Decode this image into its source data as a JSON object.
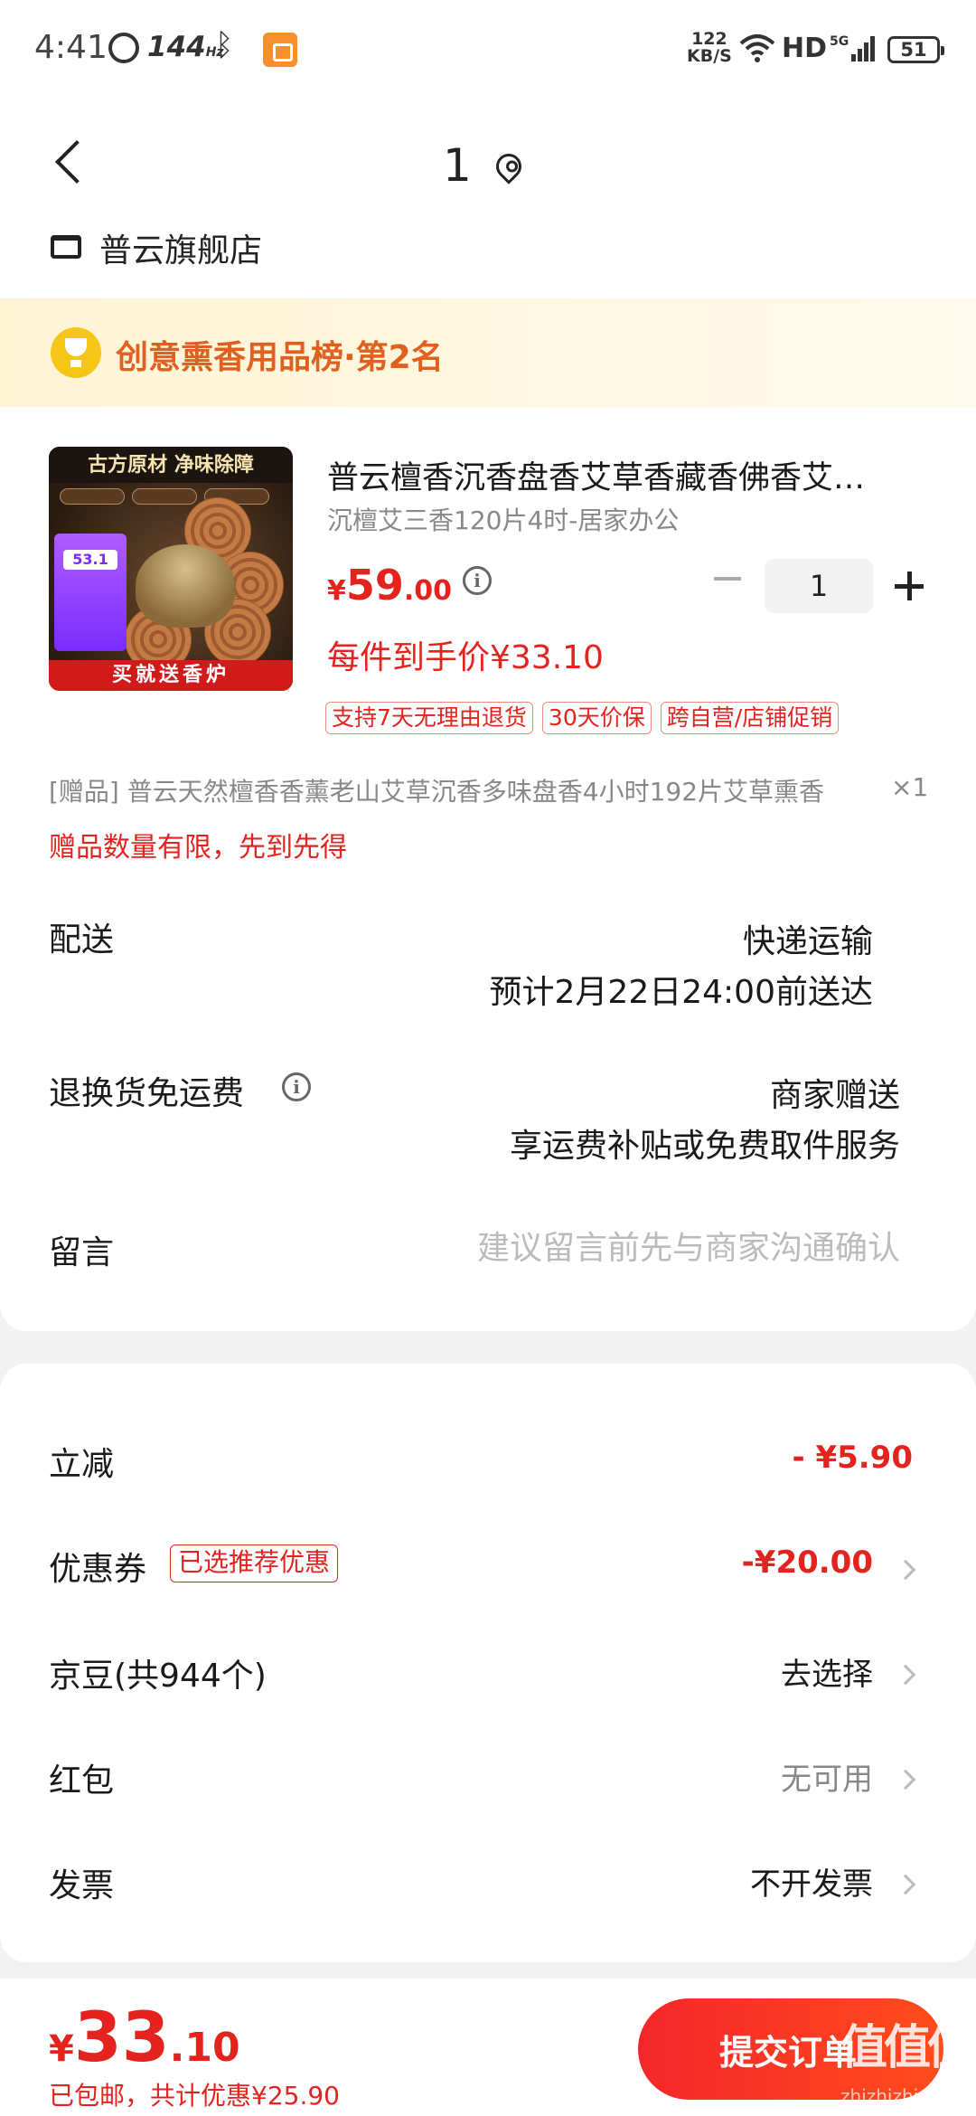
{
  "status_bar": {
    "time": "4:41",
    "refresh_rate": "144",
    "refresh_unit": "Hz",
    "net_speed": "122",
    "net_unit": "KB/S",
    "hd": "HD",
    "net_type": "5G",
    "battery": "51"
  },
  "header": {
    "address": "1",
    "shop_name": "普云旗舰店"
  },
  "rank_banner": {
    "text": "创意熏香用品榜·第2名"
  },
  "product": {
    "image": {
      "top_text": "古方原材 净味除障",
      "promo_text": "53.1",
      "bottom_text": "买就送香炉"
    },
    "title": "普云檀香沉香盘香艾草香藏香佛香艾…",
    "spec": "沉檀艾三香120片4时-居家办公",
    "price_currency": "¥",
    "price_int": "59",
    "price_dec": ".00",
    "quantity": "1",
    "final_price": "每件到手价¥33.10",
    "tags": [
      "支持7天无理由退货",
      "30天价保",
      "跨自营/店铺促销"
    ]
  },
  "gift": {
    "text": "[赠品]  普云天然檀香香薰老山艾草沉香多味盘香4小时192片艾草熏香",
    "qty": "×1",
    "note": "赠品数量有限，先到先得"
  },
  "delivery": {
    "label": "配送",
    "method": "快递运输",
    "eta": "预计2月22日24:00前送达"
  },
  "return_freight": {
    "label": "退换货免运费",
    "value1": "商家赠送",
    "value2": "享运费补贴或免费取件服务"
  },
  "message": {
    "label": "留言",
    "placeholder": "建议留言前先与商家沟通确认"
  },
  "discounts": {
    "instant_label": "立减",
    "instant_value": "- ¥5.90",
    "coupon_label": "优惠券",
    "coupon_tag": "已选推荐优惠",
    "coupon_value": "-¥20.00",
    "beans_label": "京豆(共944个)",
    "beans_value": "去选择",
    "redpacket_label": "红包",
    "redpacket_value": "无可用",
    "invoice_label": "发票",
    "invoice_value": "不开发票"
  },
  "bottom": {
    "currency": "¥",
    "total_int": "33",
    "total_dec": ".10",
    "sub": "已包邮，共计优惠¥25.90",
    "submit": "提交订单",
    "watermark": "值值值",
    "watermark_sub": "zhizhizhi.com"
  },
  "colors": {
    "accent_red": "#e4231f",
    "rank_orange": "#e0611f",
    "rank_bg": "#fff4d6",
    "page_bg": "#f2f2f2"
  }
}
